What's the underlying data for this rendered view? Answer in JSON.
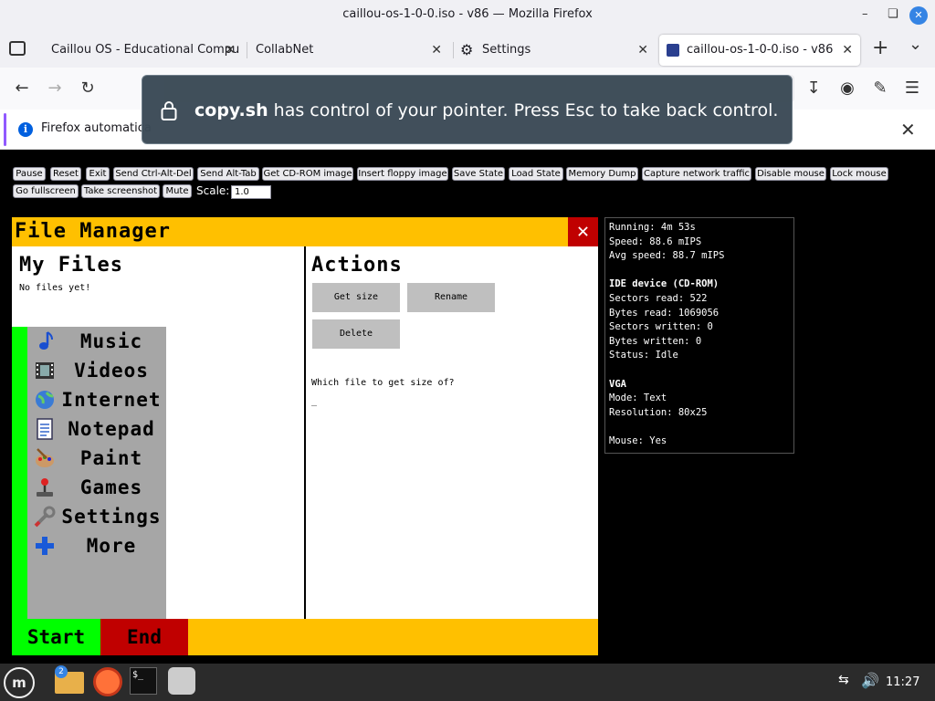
{
  "window": {
    "title": "caillou-os-1-0-0.iso - v86 — Mozilla Firefox",
    "minimize_icon": "minimize-icon",
    "maximize_icon": "restore-icon",
    "close_icon": "close-icon"
  },
  "tabs": [
    {
      "label": "Caillou OS - Educational Compu",
      "close": "✕"
    },
    {
      "label": "CollabNet",
      "close": "✕"
    },
    {
      "label": "Settings",
      "close": "✕"
    },
    {
      "label": "caillou-os-1-0-0.iso - v86",
      "close": "✕"
    }
  ],
  "tabbar": {
    "new_tab": "+",
    "list_all": "⌄"
  },
  "notification": {
    "text": "Firefox automatica",
    "close": "✕"
  },
  "pointer_lock": {
    "site": "copy.sh",
    "message": " has control of your pointer. Press Esc to take back control."
  },
  "controls": {
    "row1": [
      "Pause",
      "Reset",
      "Exit",
      "Send Ctrl-Alt-Del",
      "Send Alt-Tab",
      "Get CD-ROM image",
      "Insert floppy image",
      "Save State",
      "Load State",
      "Memory Dump",
      "Capture network traffic",
      "Disable mouse",
      "Lock mouse"
    ],
    "row2": [
      "Go fullscreen",
      "Take screenshot",
      "Mute"
    ],
    "scale_label": "Scale:",
    "scale_value": "1.0"
  },
  "file_manager": {
    "title": "File Manager",
    "close": "✕",
    "my_files_heading": "My Files",
    "no_files": "No files yet!",
    "actions_heading": "Actions",
    "buttons": {
      "get_size": "Get size",
      "rename": "Rename",
      "delete": "Delete"
    },
    "prompt": "Which file to get size of?",
    "cursor": "_"
  },
  "app_menu": [
    {
      "label": "Music",
      "icon": "music-note-icon"
    },
    {
      "label": "Videos",
      "icon": "film-icon"
    },
    {
      "label": "Internet",
      "icon": "globe-icon"
    },
    {
      "label": "Notepad",
      "icon": "notepad-icon"
    },
    {
      "label": "Paint",
      "icon": "paint-palette-icon"
    },
    {
      "label": "Games",
      "icon": "joystick-icon"
    },
    {
      "label": "Settings",
      "icon": "wrench-icon"
    },
    {
      "label": "More",
      "icon": "plus-icon"
    }
  ],
  "bottom_bar": {
    "start": "Start",
    "end": "End"
  },
  "stats": [
    {
      "text": "Running: 4m 53s",
      "bold": false
    },
    {
      "text": "Speed: 88.6 mIPS",
      "bold": false
    },
    {
      "text": "Avg speed: 88.7 mIPS",
      "bold": false
    },
    {
      "text": "",
      "bold": false
    },
    {
      "text": "IDE device (CD-ROM)",
      "bold": true
    },
    {
      "text": "Sectors read: 522",
      "bold": false
    },
    {
      "text": "Bytes read: 1069056",
      "bold": false
    },
    {
      "text": "Sectors written: 0",
      "bold": false
    },
    {
      "text": "Bytes written: 0",
      "bold": false
    },
    {
      "text": "Status: Idle",
      "bold": false
    },
    {
      "text": "",
      "bold": false
    },
    {
      "text": "VGA",
      "bold": true
    },
    {
      "text": "Mode: Text",
      "bold": false
    },
    {
      "text": "Resolution: 80x25",
      "bold": false
    },
    {
      "text": "",
      "bold": false
    },
    {
      "text": "Mouse: Yes",
      "bold": false
    }
  ],
  "taskbar": {
    "clock": "11:27",
    "files_badge": "2"
  },
  "colors": {
    "fm_yellow": "#ffc000",
    "fm_red": "#c00000",
    "fm_green": "#00ff00",
    "menu_gray": "#a6a6a6"
  }
}
